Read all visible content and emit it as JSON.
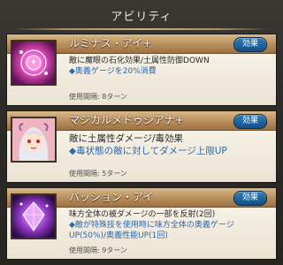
{
  "header": {
    "title": "アビリティ"
  },
  "abilities": [
    {
      "name": "ルミナス・アイ+",
      "button": "効果",
      "desc1": "敵に魔眼の石化効果/土属性防御DOWN",
      "desc2": "◆奥義ゲージを20%消費",
      "cooldown": "使用間隔: 8ターン",
      "icon": "pink-magic-orb-icon"
    },
    {
      "name": "マジカルメドゥシアナ+",
      "button": "効果",
      "desc1": "敵に土属性ダメージ/毒効果",
      "desc2": "◆毒状態の敵に対してダメージ上限UP",
      "cooldown": "使用間隔: 5ターン",
      "icon": "medusa-portrait-icon"
    },
    {
      "name": "パッション・アイ",
      "button": "効果",
      "desc1": "味方全体の被ダメージの一部を反射(2回)",
      "desc2": "◆敵が特殊技を使用時に味方全体の奥義ゲージUP(50%)/奥義性能UP(1回)",
      "cooldown": "使用間隔: 9ターン",
      "icon": "purple-crystal-icon"
    }
  ],
  "colors": {
    "header_gold": "#c8a06c",
    "button_blue": "#1f67a3",
    "sub_text_blue": "#2a68b0"
  }
}
